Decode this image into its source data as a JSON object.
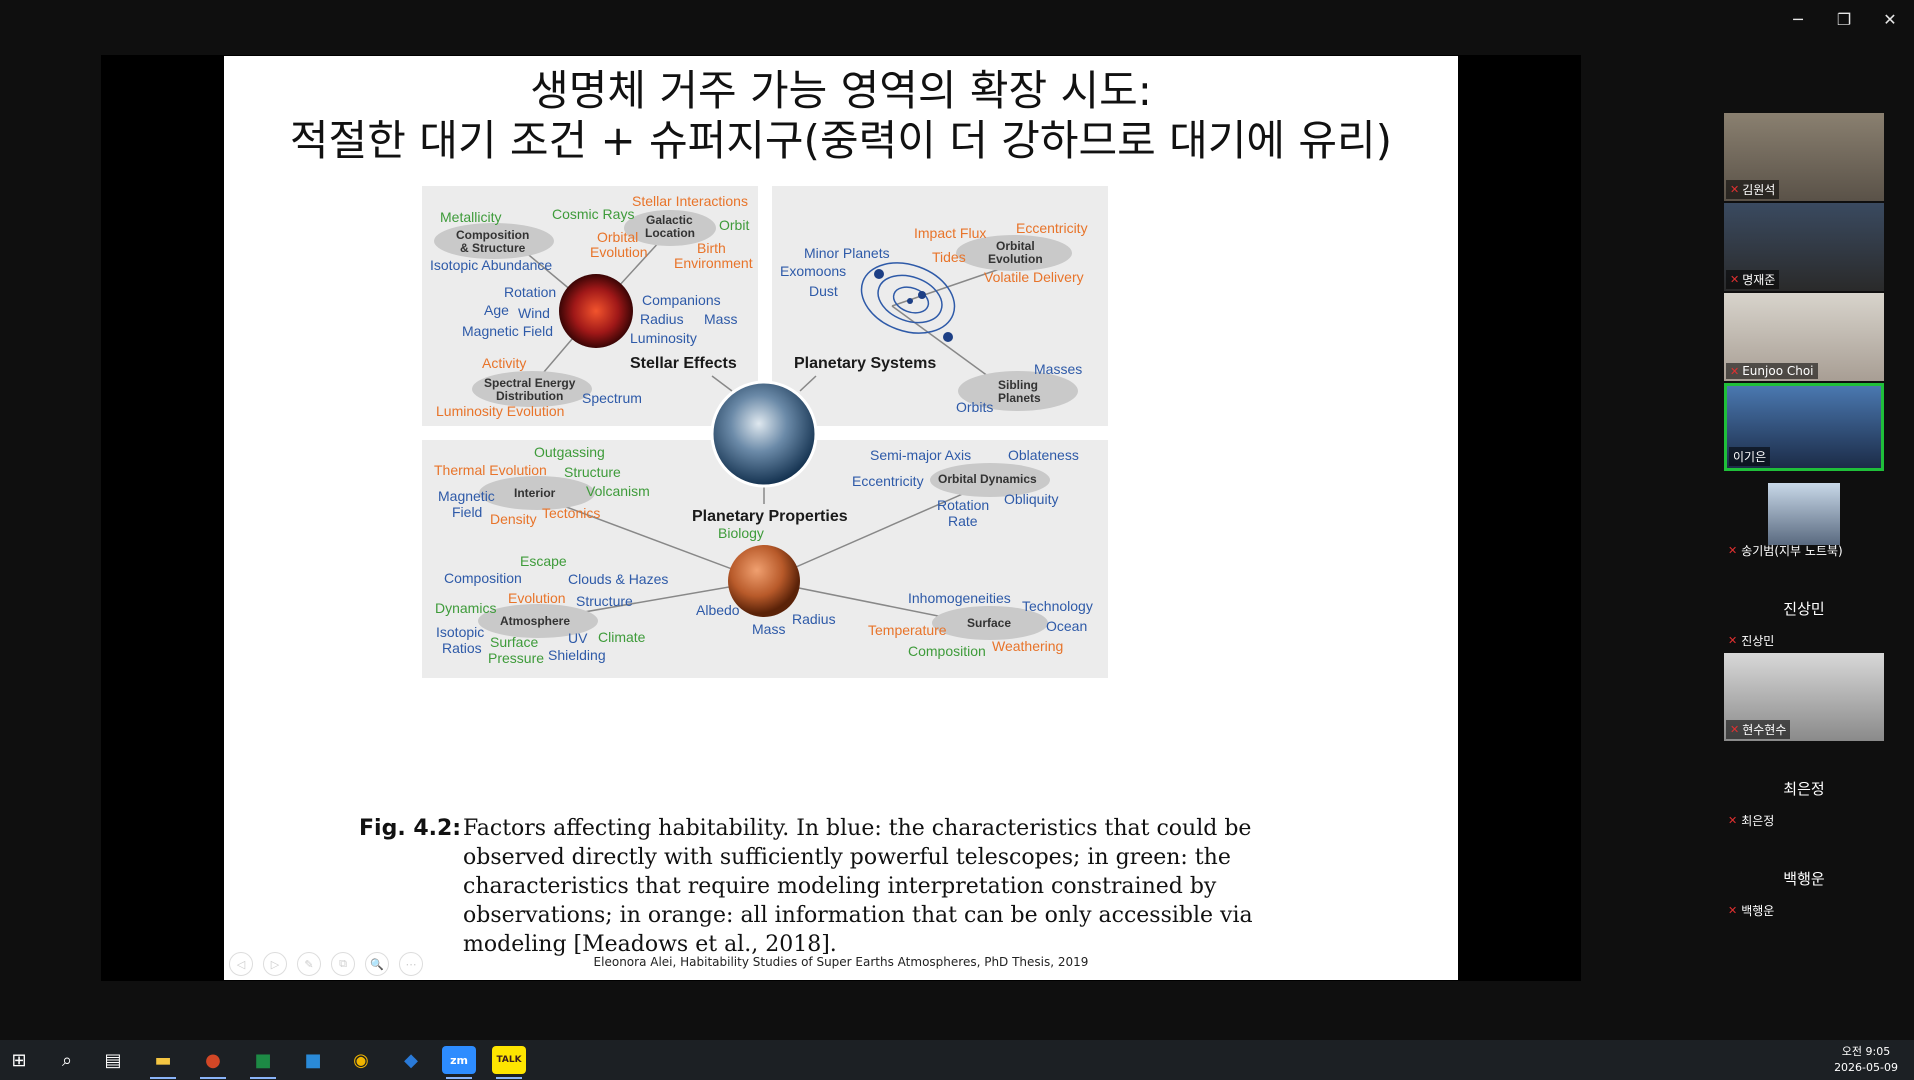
{
  "window_controls": {
    "minimize": "─",
    "restore": "❐",
    "close": "✕"
  },
  "slide": {
    "title_line1": "생명체 거주 가능 영역의 확장 시도:",
    "title_line2": "적절한 대기 조건 + 슈퍼지구(중력이 더 강하므로 대기에 유리)",
    "caption_label": "Fig. 4.2:",
    "caption_text": "Factors affecting habitability. In blue: the characteristics that could be observed directly with sufficiently powerful telescopes; in green: the characteristics that require modeling interpretation constrained by observations; in orange: all information that can be only accessible via modeling [Meadows et al., 2018].",
    "credit": "Eleonora Alei, Habitability Studies of Super Earths Atmospheres, PhD Thesis, 2019",
    "controls": [
      "◁",
      "▷",
      "✎",
      "⧉",
      "🔍",
      "⋯"
    ]
  },
  "diagram": {
    "stellar": {
      "heading": "Stellar Effects",
      "metallicity": "Metallicity",
      "cosmic_rays": "Cosmic Rays",
      "stellar_interactions": "Stellar Interactions",
      "comp_structure_1": "Composition",
      "comp_structure_2": "& Structure",
      "galactic_1": "Galactic",
      "galactic_2": "Location",
      "orbit": "Orbit",
      "orbital_ev_1": "Orbital",
      "orbital_ev_2": "Evolution",
      "birth_1": "Birth",
      "birth_2": "Environment",
      "isotopic_abundance": "Isotopic Abundance",
      "rotation": "Rotation",
      "age": "Age",
      "wind": "Wind",
      "magnetic_field": "Magnetic Field",
      "companions": "Companions",
      "radius": "Radius",
      "mass": "Mass",
      "luminosity": "Luminosity",
      "activity": "Activity",
      "sed_1": "Spectral Energy",
      "sed_2": "Distribution",
      "spectrum": "Spectrum",
      "lum_evolution": "Luminosity Evolution"
    },
    "systems": {
      "heading": "Planetary Systems",
      "minor_planets": "Minor Planets",
      "exomoons": "Exomoons",
      "dust": "Dust",
      "impact_flux": "Impact Flux",
      "tides": "Tides",
      "eccentricity": "Eccentricity",
      "orbital_ev_1": "Orbital",
      "orbital_ev_2": "Evolution",
      "volatile_delivery": "Volatile Delivery",
      "masses": "Masses",
      "sibling_1": "Sibling",
      "sibling_2": "Planets",
      "orbits": "Orbits"
    },
    "properties": {
      "heading": "Planetary Properties",
      "outgassing": "Outgassing",
      "thermal_evolution": "Thermal Evolution",
      "structure": "Structure",
      "magnetic_1": "Magnetic",
      "magnetic_2": "Field",
      "interior": "Interior",
      "volcanism": "Volcanism",
      "density": "Density",
      "tectonics": "Tectonics",
      "semi_major": "Semi-major Axis",
      "oblateness": "Oblateness",
      "eccentricity": "Eccentricity",
      "orbital_dynamics": "Orbital Dynamics",
      "obliquity": "Obliquity",
      "rotation_1": "Rotation",
      "rotation_2": "Rate",
      "biology": "Biology",
      "escape": "Escape",
      "composition": "Composition",
      "clouds_hazes": "Clouds & Hazes",
      "evolution": "Evolution",
      "structure2": "Structure",
      "dynamics": "Dynamics",
      "atmosphere": "Atmosphere",
      "isotopic_1": "Isotopic",
      "isotopic_2": "Ratios",
      "surface_p1": "Surface",
      "surface_p2": "Pressure",
      "uv_1": "UV",
      "uv_2": "Shielding",
      "climate": "Climate",
      "albedo": "Albedo",
      "mass": "Mass",
      "radius": "Radius",
      "inhomogeneities": "Inhomogeneities",
      "technology": "Technology",
      "surface": "Surface",
      "ocean": "Ocean",
      "temperature": "Temperature",
      "weathering": "Weathering",
      "surf_composition": "Composition"
    }
  },
  "participants": [
    {
      "name": "김원석"
    },
    {
      "name": "명재준"
    },
    {
      "name": "Eunjoo Choi"
    },
    {
      "name": "이기은"
    },
    {
      "name": "송기범(지부 노트북)"
    },
    {
      "name": "진상민",
      "label": "진상민"
    },
    {
      "name": "현수현수"
    },
    {
      "name": "최은정",
      "label": "최은정"
    },
    {
      "name": "백행운",
      "label": "백행운"
    }
  ],
  "taskbar": {
    "time": "오전 9:05",
    "date": "2026-05-09",
    "icons": [
      "windows-icon",
      "search-icon",
      "task-view-icon",
      "file-explorer-icon",
      "powerpoint-icon",
      "excel-icon",
      "hwp-icon",
      "chrome-icon",
      "arrow-app-icon",
      "zoom-icon",
      "kakaotalk-icon"
    ],
    "zoom_label": "zm",
    "kakao_label": "TALK"
  }
}
